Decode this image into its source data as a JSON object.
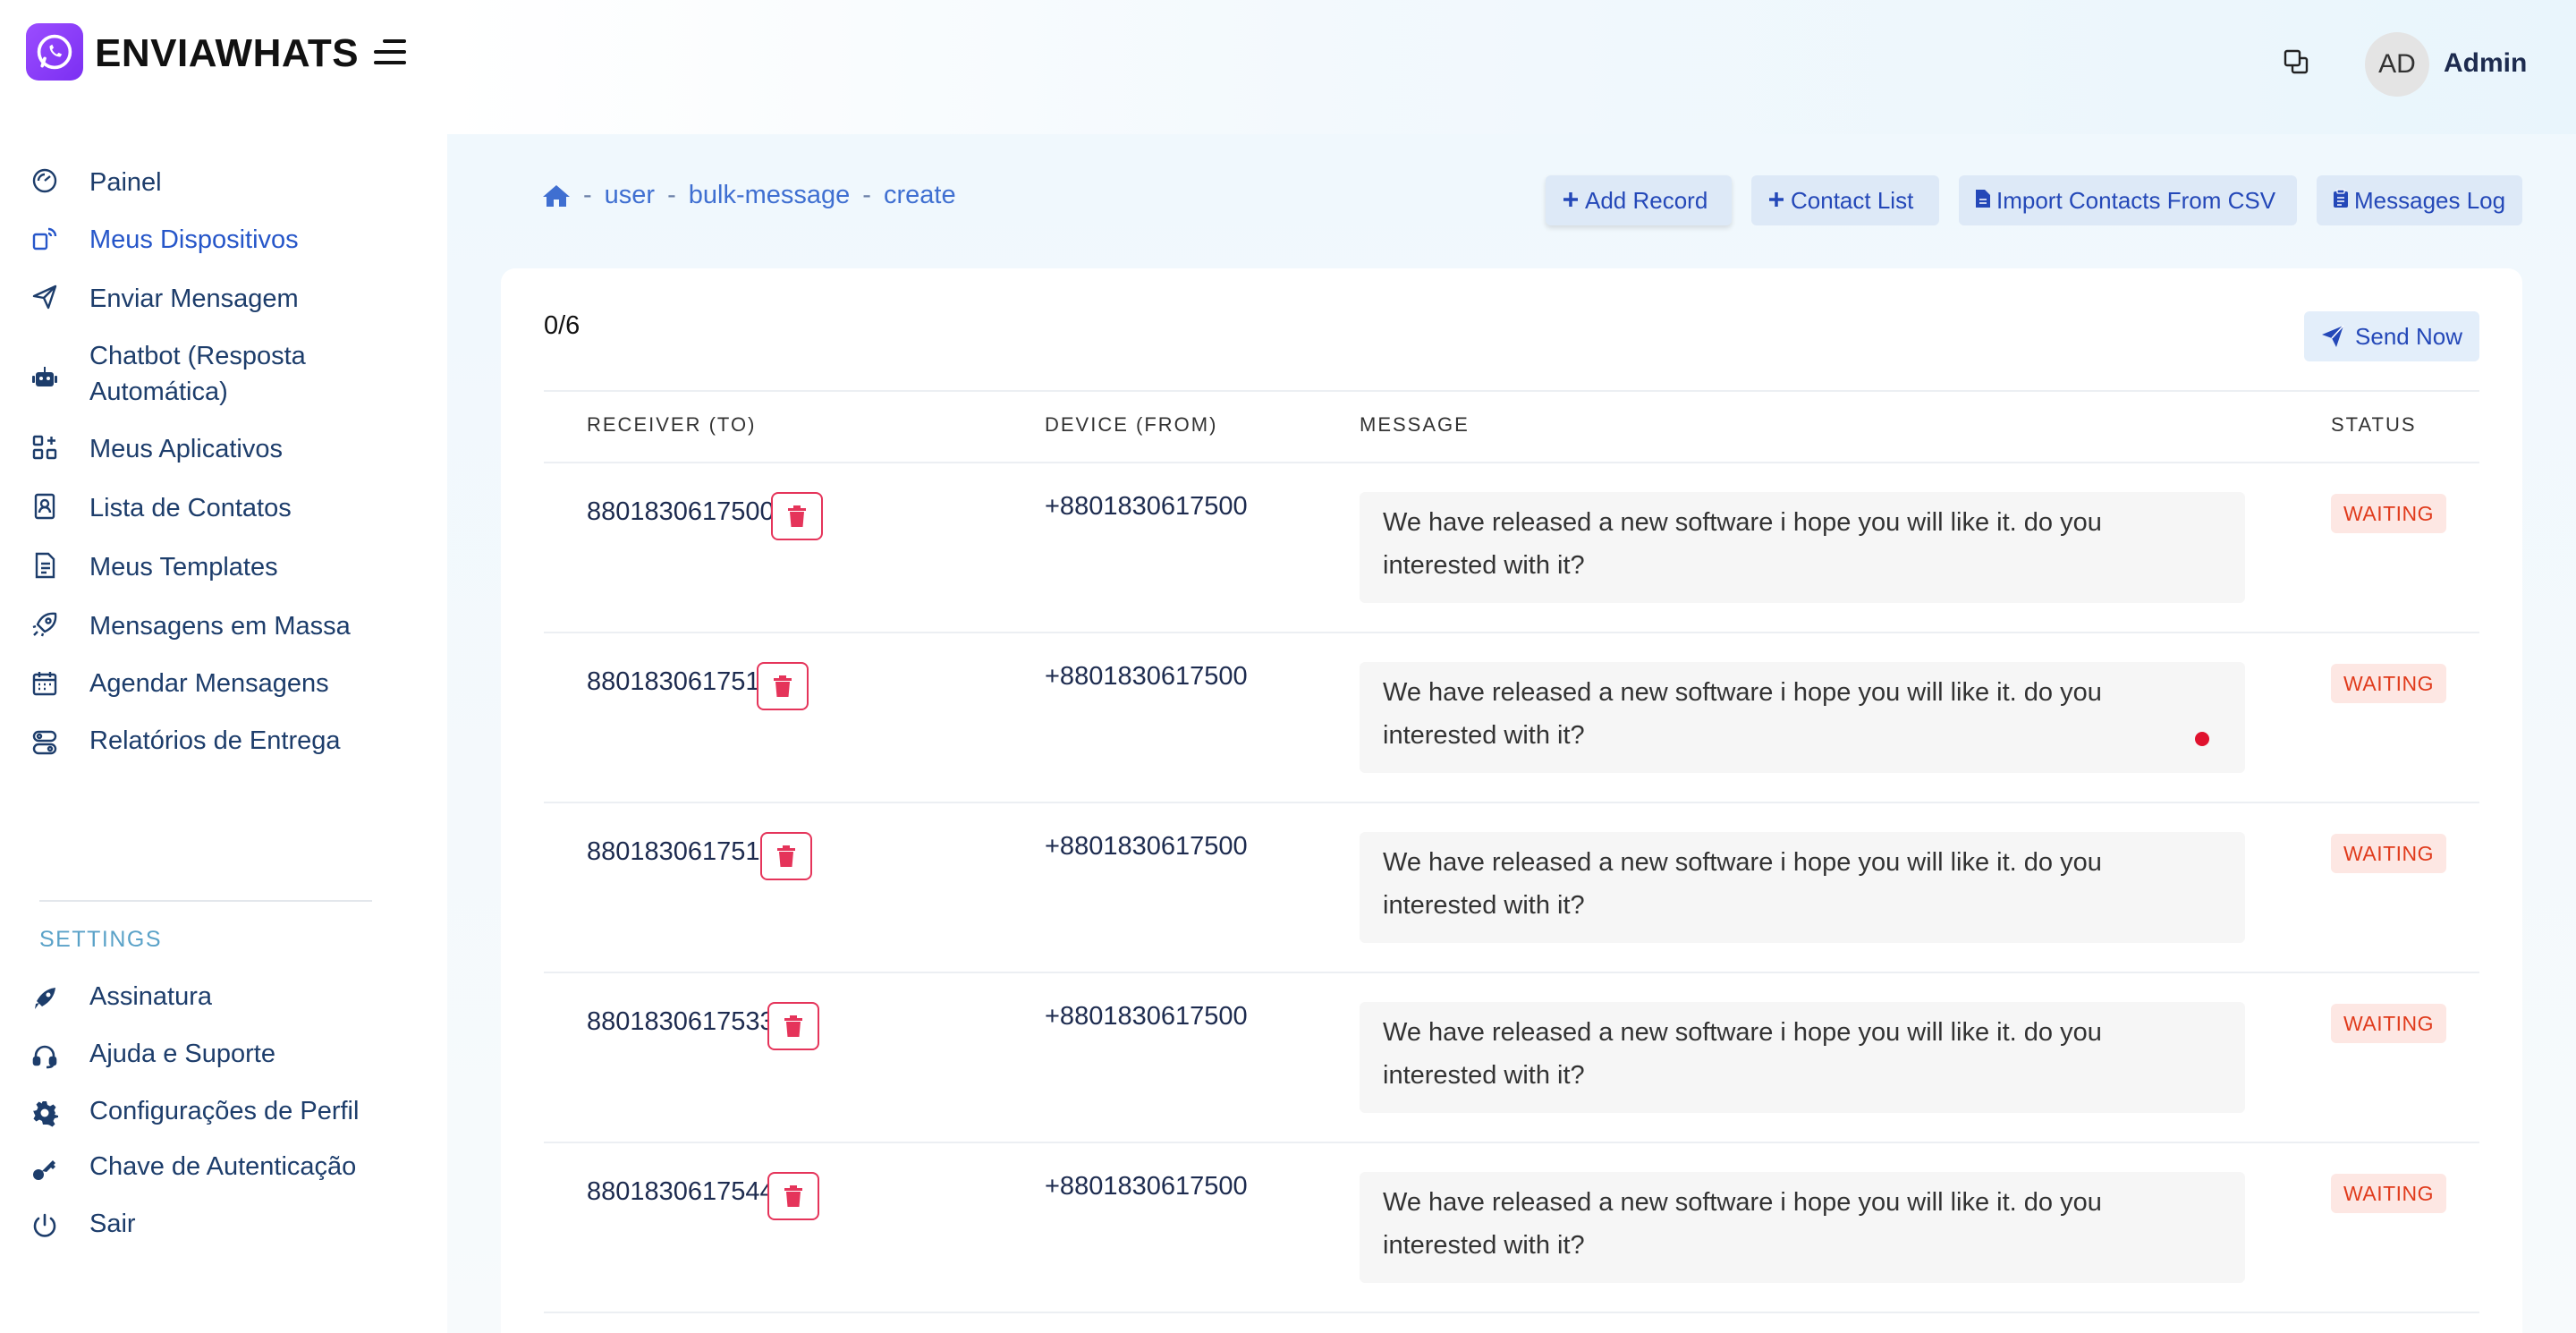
{
  "header": {
    "brand": "ENVIAWHATS",
    "user_initials": "AD",
    "user_name": "Admin"
  },
  "sidebar": {
    "items": [
      {
        "label": "Painel",
        "icon": "dashboard-icon"
      },
      {
        "label": "Meus Dispositivos",
        "icon": "devices-icon",
        "active": true
      },
      {
        "label": "Enviar Mensagem",
        "icon": "send-icon"
      },
      {
        "label": "Chatbot (Resposta Automática)",
        "icon": "robot-icon"
      },
      {
        "label": "Meus Aplicativos",
        "icon": "apps-icon"
      },
      {
        "label": "Lista de Contatos",
        "icon": "contact-book-icon"
      },
      {
        "label": "Meus Templates",
        "icon": "template-icon"
      },
      {
        "label": "Mensagens em Massa",
        "icon": "rocket-icon"
      },
      {
        "label": "Agendar Mensagens",
        "icon": "calendar-icon"
      },
      {
        "label": "Relatórios de Entrega",
        "icon": "report-icon"
      }
    ],
    "settings_heading": "SETTINGS",
    "settings_items": [
      {
        "label": "Assinatura",
        "icon": "subscription-icon"
      },
      {
        "label": "Ajuda e Suporte",
        "icon": "headset-icon"
      },
      {
        "label": "Configurações de Perfil",
        "icon": "gear-icon"
      },
      {
        "label": "Chave de Autenticação",
        "icon": "key-icon"
      },
      {
        "label": "Sair",
        "icon": "power-icon"
      }
    ]
  },
  "breadcrumb": {
    "items": [
      "user",
      "bulk-message",
      "create"
    ]
  },
  "toolbar": {
    "add_record": "Add Record",
    "contact_list": "Contact List",
    "import_csv": "Import Contacts From CSV",
    "messages_log": "Messages Log"
  },
  "queue": {
    "counter": "0/6",
    "send_now": "Send Now"
  },
  "table": {
    "headers": [
      "RECEIVER (TO)",
      "DEVICE (FROM)",
      "MESSAGE",
      "STATUS"
    ],
    "rows": [
      {
        "receiver": "8801830617500",
        "device": "+8801830617500",
        "message": "We have released a new software i hope you will like it. do you interested with it?",
        "status": "WAITING"
      },
      {
        "receiver": "8801830617511",
        "device": "+8801830617500",
        "message": "We have released a new software i hope you will like it. do you interested with it?",
        "status": "WAITING"
      },
      {
        "receiver": "8801830617512",
        "device": "+8801830617500",
        "message": "We have released a new software i hope you will like it. do you interested with it?",
        "status": "WAITING"
      },
      {
        "receiver": "8801830617533",
        "device": "+8801830617500",
        "message": "We have released a new software i hope you will like it. do you interested with it?",
        "status": "WAITING"
      },
      {
        "receiver": "8801830617544",
        "device": "+8801830617500",
        "message": "We have released a new software i hope you will like it. do you interested with it?",
        "status": "WAITING"
      }
    ]
  },
  "colors": {
    "accent": "#2448b8",
    "link": "#3f6fd1",
    "danger": "#e5345a",
    "status_waiting_bg": "#fde7e3",
    "status_waiting_text": "#e03b1c"
  }
}
